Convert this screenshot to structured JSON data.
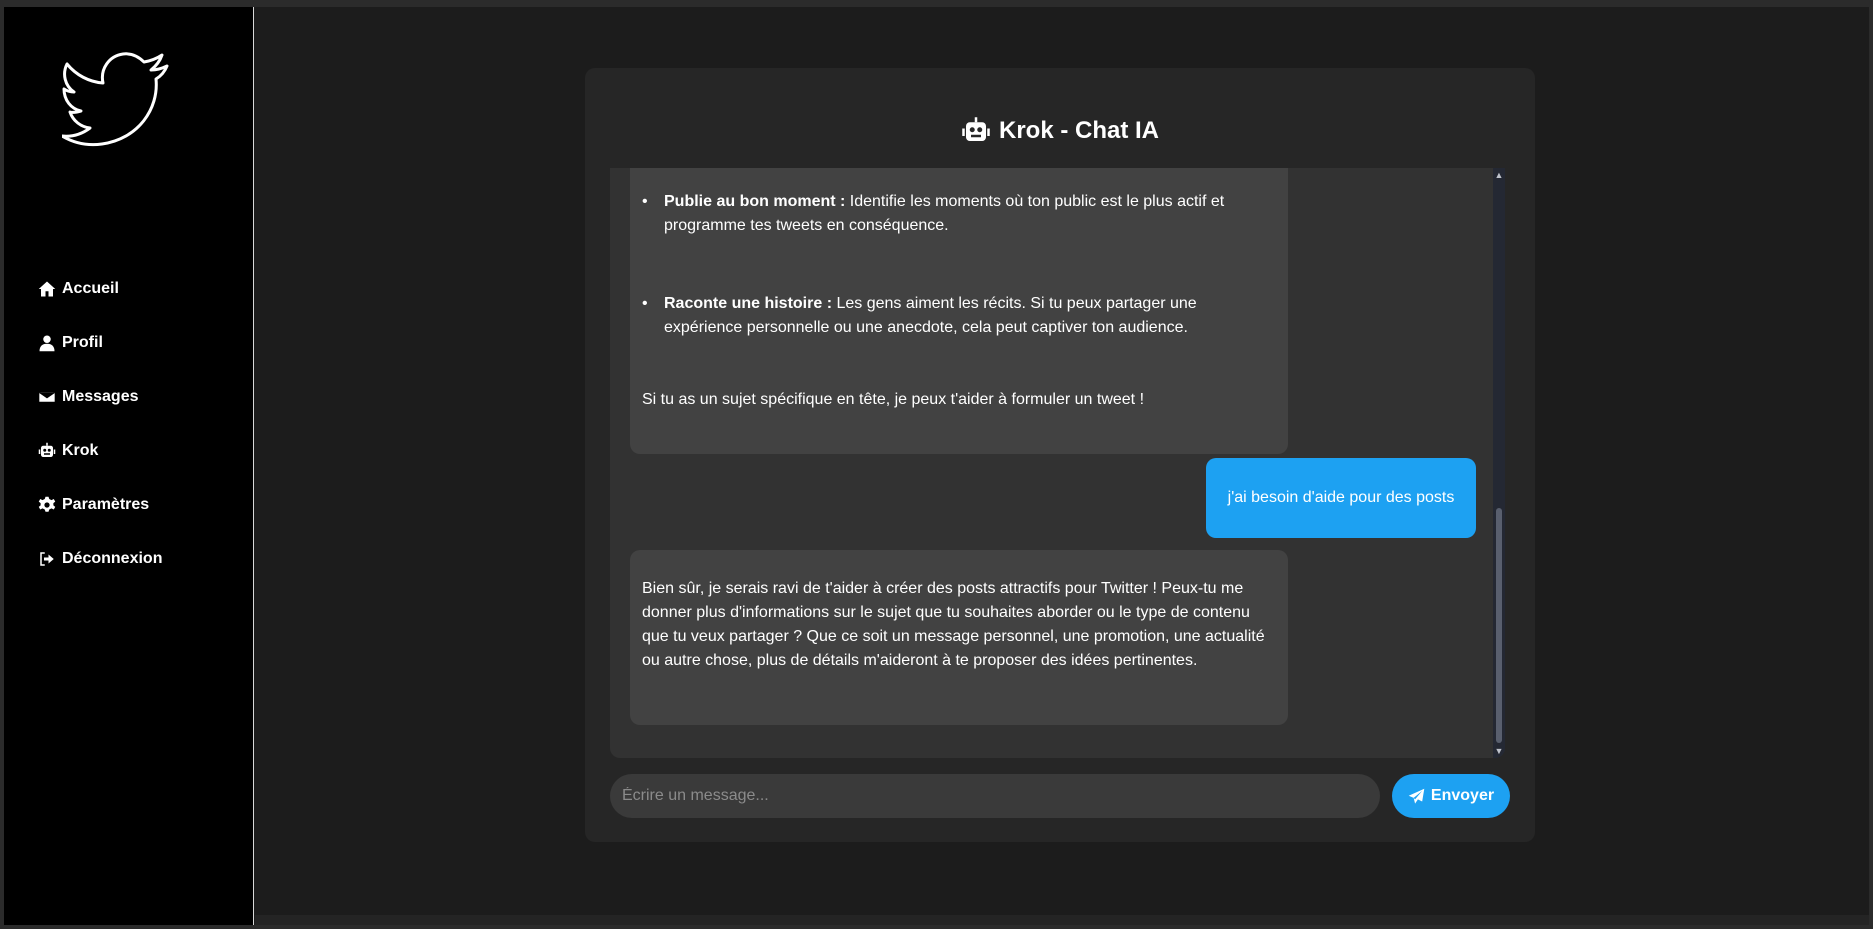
{
  "brand": {
    "logo_icon": "twitter-bird-icon"
  },
  "sidebar": {
    "items": [
      {
        "label": "Accueil",
        "icon": "home-icon"
      },
      {
        "label": "Profil",
        "icon": "user-icon"
      },
      {
        "label": "Messages",
        "icon": "envelope-icon"
      },
      {
        "label": "Krok",
        "icon": "robot-icon"
      },
      {
        "label": "Paramètres",
        "icon": "gear-icon"
      },
      {
        "label": "Déconnexion",
        "icon": "sign-out-icon"
      }
    ]
  },
  "chat": {
    "title": "Krok - Chat IA",
    "title_icon": "robot-icon",
    "messages": [
      {
        "role": "bot",
        "bullets": [
          {
            "bold": "Publie au bon moment :",
            "text": " Identifie les moments où ton public est le plus actif et programme tes tweets en conséquence."
          },
          {
            "bold": "Raconte une histoire :",
            "text": " Les gens aiment les récits. Si tu peux partager une expérience personnelle ou une anecdote, cela peut captiver ton audience."
          }
        ],
        "closing": "Si tu as un sujet spécifique en tête, je peux t'aider à formuler un tweet !"
      },
      {
        "role": "user",
        "text": "j'ai besoin d'aide pour des posts"
      },
      {
        "role": "bot",
        "text": "Bien sûr, je serais ravi de t'aider à créer des posts attractifs pour Twitter ! Peux-tu me donner plus d'informations sur le sujet que tu souhaites aborder ou le type de contenu que tu veux partager ? Que ce soit un message personnel, une promotion, une actualité ou autre chose, plus de détails m'aideront à te proposer des idées pertinentes."
      }
    ],
    "input": {
      "placeholder": "Écrire un message...",
      "value": ""
    },
    "send_label": "Envoyer",
    "send_icon": "paper-plane-icon"
  },
  "colors": {
    "accent": "#1da1f2",
    "sidebar_bg": "#000000",
    "panel_bg": "#262626",
    "bubble_bot": "#424242"
  }
}
